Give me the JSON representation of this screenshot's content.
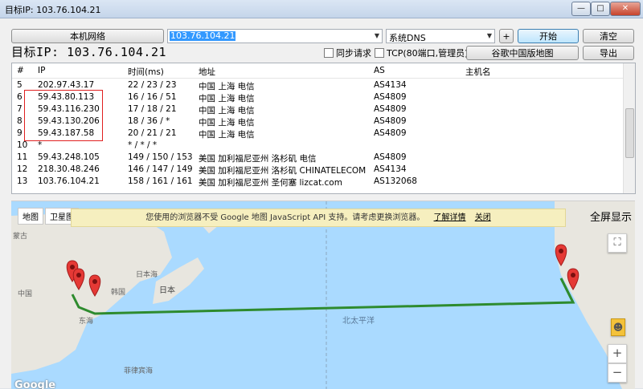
{
  "window": {
    "title": "目标IP: 103.76.104.21",
    "min": "—",
    "max": "□",
    "close": "✕"
  },
  "toolbar": {
    "local_network": "本机网络",
    "ip_input": "103.76.104.21",
    "dns_select": "系统DNS",
    "plus": "+",
    "start": "开始",
    "clear": "清空",
    "sync_label": "同步请求",
    "tcp_label": "TCP(80端口,管理员)",
    "google_map": "谷歌中国版地图",
    "export": "导出"
  },
  "target_title": "目标IP:  103.76.104.21",
  "table": {
    "headers": [
      "#",
      "IP",
      "时间(ms)",
      "地址",
      "AS",
      "主机名"
    ],
    "rows": [
      [
        "5",
        "202.97.43.17",
        "22 / 23 / 23",
        "中国 上海 电信",
        "AS4134",
        ""
      ],
      [
        "6",
        "59.43.80.113",
        "16 / 16 / 51",
        "中国 上海 电信",
        "AS4809",
        ""
      ],
      [
        "7",
        "59.43.116.230",
        "17 / 18 / 21",
        "中国 上海 电信",
        "AS4809",
        ""
      ],
      [
        "8",
        "59.43.130.206",
        "18 / 36 / *",
        "中国 上海 电信",
        "AS4809",
        ""
      ],
      [
        "9",
        "59.43.187.58",
        "20 / 21 / 21",
        "中国 上海 电信",
        "AS4809",
        ""
      ],
      [
        "10",
        "*",
        "* / * / *",
        "",
        "",
        ""
      ],
      [
        "11",
        "59.43.248.105",
        "149 / 150 / 153",
        "美国 加利福尼亚州 洛杉矶 电信",
        "AS4809",
        ""
      ],
      [
        "12",
        "218.30.48.246",
        "146 / 147 / 149",
        "美国 加利福尼亚州 洛杉矶 CHINATELECOM",
        "AS4134",
        ""
      ],
      [
        "13",
        "103.76.104.21",
        "158 / 161 / 161",
        "美国 加利福尼亚州 圣何塞 lizcat.com",
        "AS132068",
        ""
      ]
    ]
  },
  "map": {
    "tab_map": "地图",
    "tab_satellite": "卫星图",
    "notice": "您使用的浏览器不受 Google 地图 JavaScript API 支持。请考虑更换浏览器。",
    "learn_more": "了解详情",
    "close": "关闭",
    "fullscreen": "全屏显示",
    "zoom_in": "+",
    "zoom_out": "−",
    "labels": {
      "mongolia": "蒙古",
      "china": "中国",
      "korea": "韩国",
      "japan_sea": "日本海",
      "japan": "日本",
      "east_sea": "东海",
      "pacific": "北太平洋",
      "philippine_sea": "菲律宾海"
    },
    "logo": "Google",
    "route_color": "#2e8b2e",
    "pin_color": "#e53935"
  }
}
